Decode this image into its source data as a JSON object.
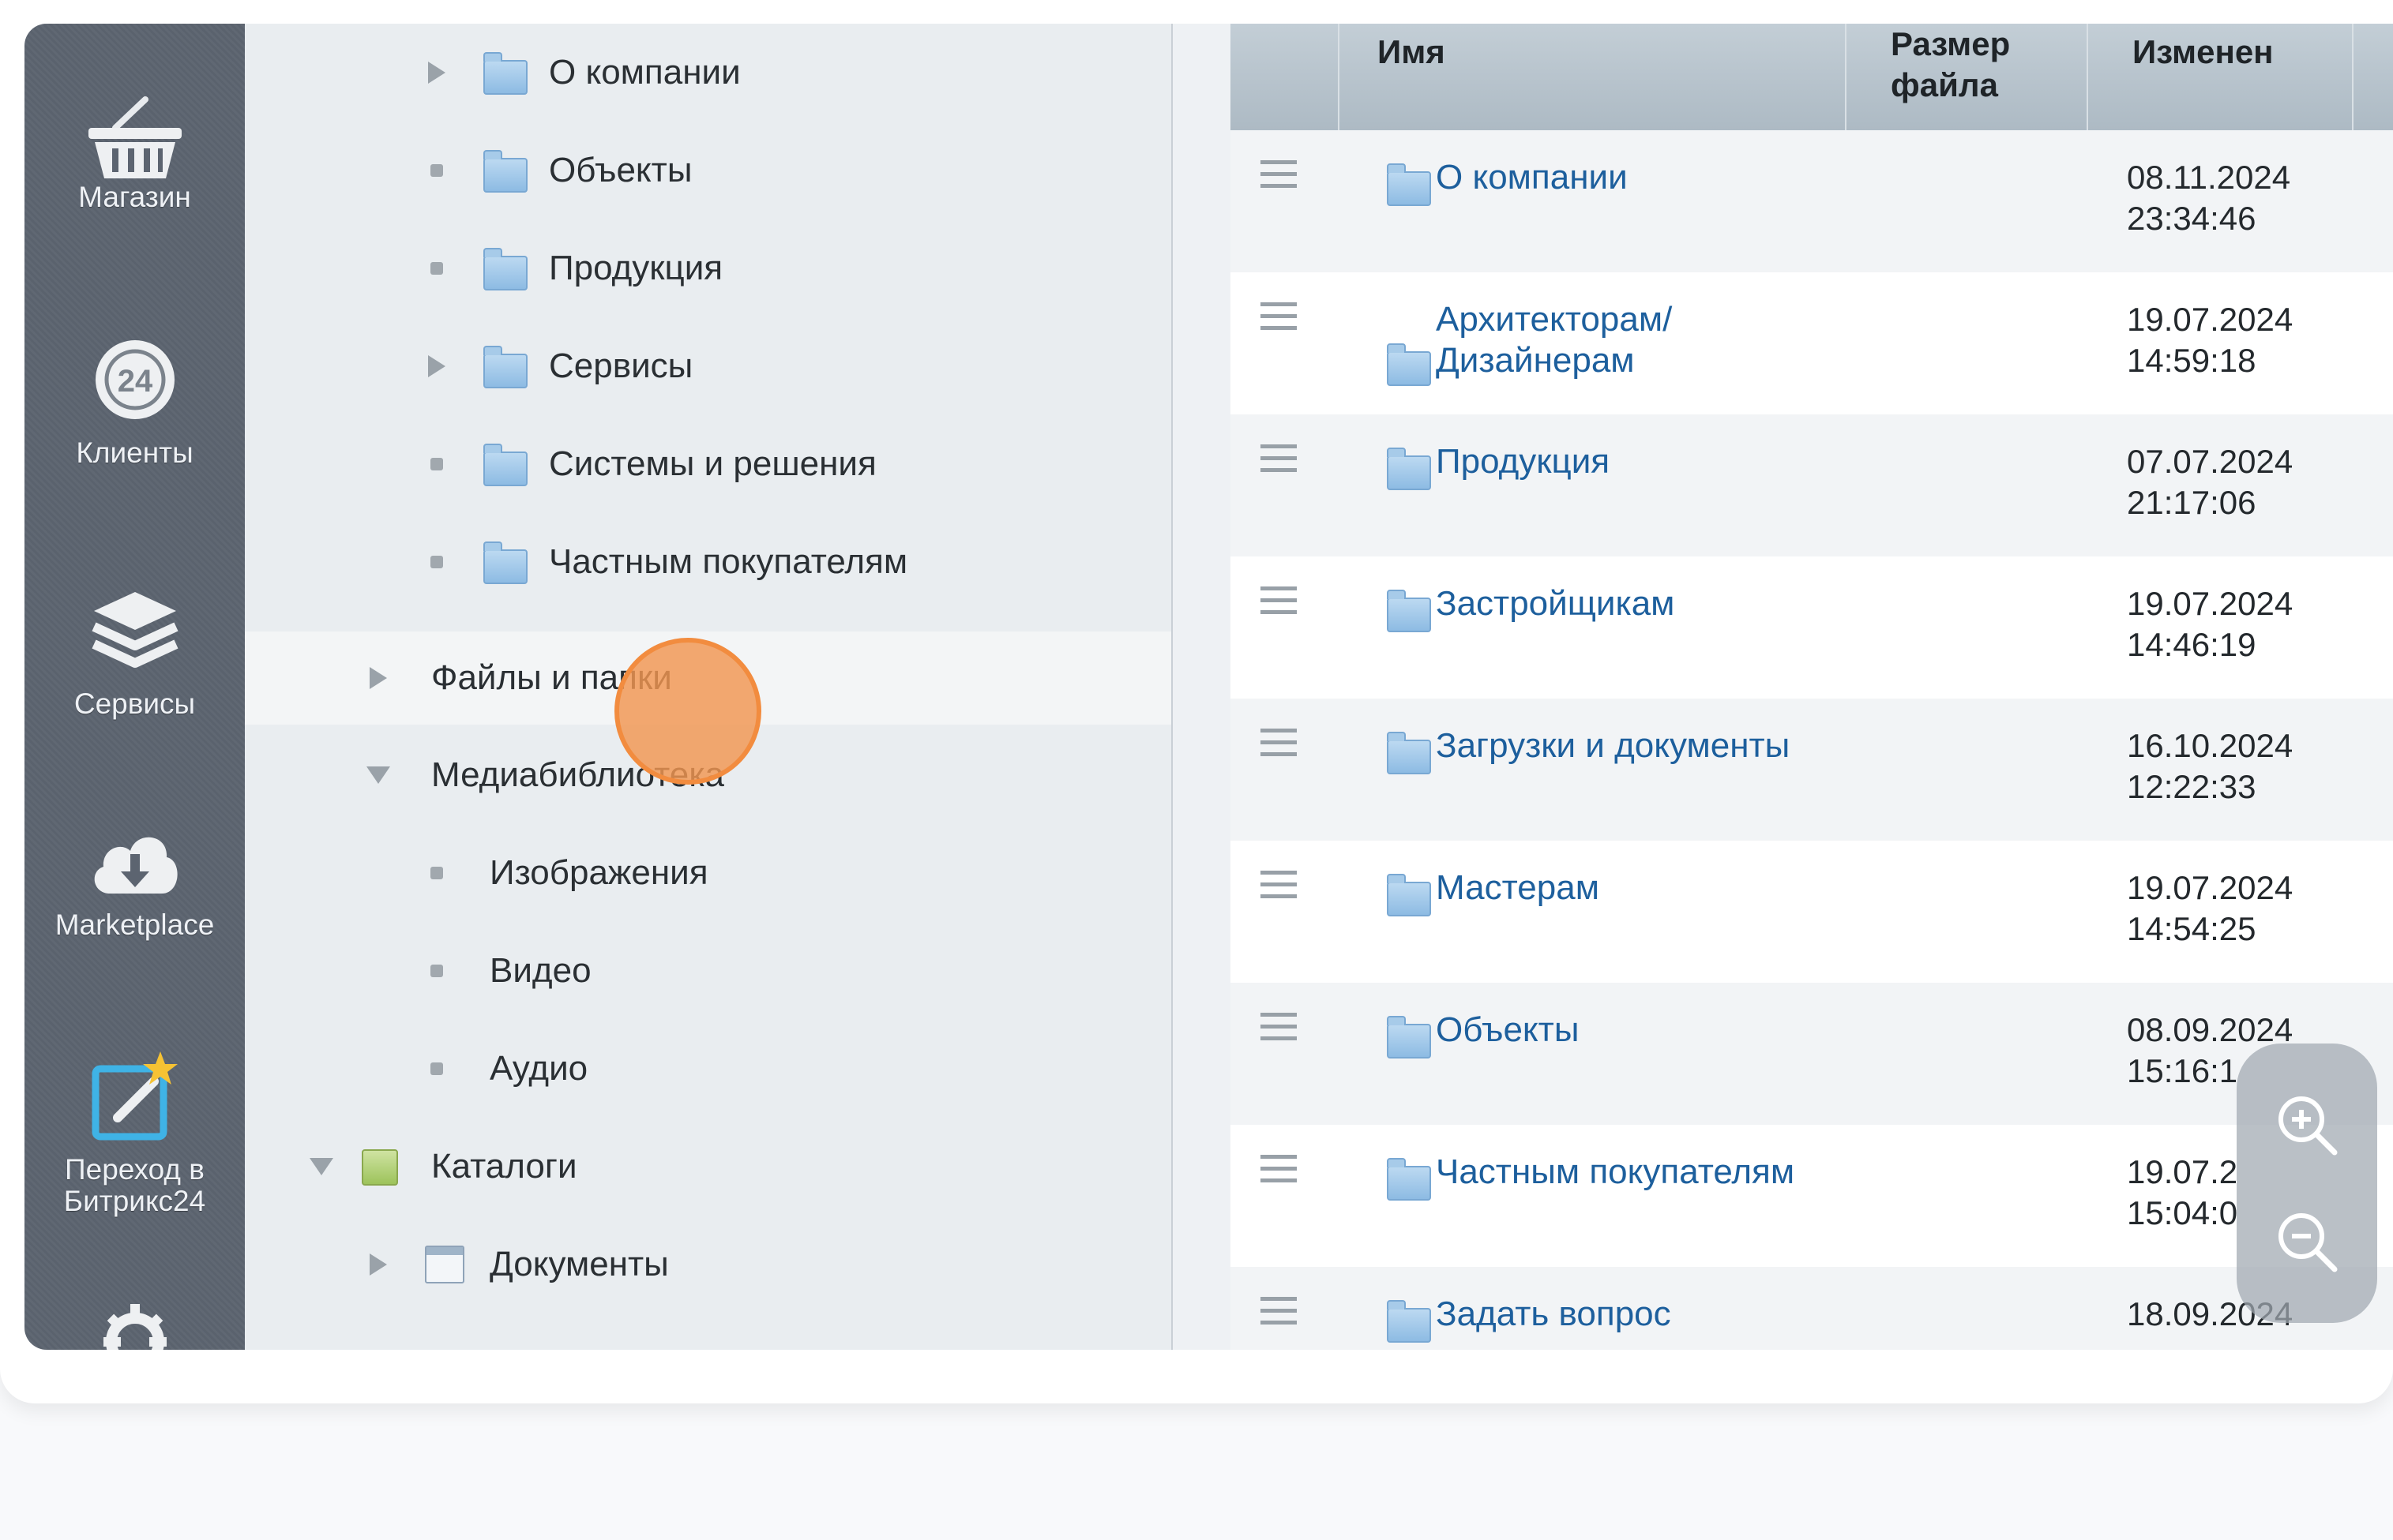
{
  "rail": {
    "items": [
      {
        "label": "Магазин",
        "icon": "basket-icon"
      },
      {
        "label": "Клиенты",
        "icon": "bitrix24-icon"
      },
      {
        "label": "Сервисы",
        "icon": "layers-icon"
      },
      {
        "label": "Marketplace",
        "icon": "cloud-download-icon"
      },
      {
        "label": "Переход в\nБитрикс24",
        "icon": "edit-star-icon"
      },
      {
        "label": "",
        "icon": "gear-icon"
      }
    ]
  },
  "tree": {
    "items": [
      {
        "label": "О компании",
        "marker": "arrow"
      },
      {
        "label": "Объекты",
        "marker": "bullet"
      },
      {
        "label": "Продукция",
        "marker": "bullet"
      },
      {
        "label": "Сервисы",
        "marker": "arrow"
      },
      {
        "label": "Системы и решения",
        "marker": "bullet"
      },
      {
        "label": "Частным покупателям",
        "marker": "bullet"
      },
      {
        "label": "Файлы и папки",
        "marker": "arrow",
        "active": true
      },
      {
        "label": "Медиабиблиотека",
        "marker": "arrow-down"
      },
      {
        "label": "Изображения",
        "marker": "bullet"
      },
      {
        "label": "Видео",
        "marker": "bullet"
      },
      {
        "label": "Аудио",
        "marker": "bullet"
      },
      {
        "label": "Каталоги",
        "marker": "arrow-down"
      },
      {
        "label": "Документы",
        "marker": "arrow"
      }
    ]
  },
  "table": {
    "columns": {
      "name": "Имя",
      "size": "Размер файла",
      "modified": "Изменен"
    },
    "rows": [
      {
        "name": "О компании",
        "modified": "08.11.2024\n23:34:46"
      },
      {
        "name": "Архитекторам/ Дизайнерам",
        "modified": "19.07.2024\n14:59:18"
      },
      {
        "name": "Продукция",
        "modified": "07.07.2024\n21:17:06"
      },
      {
        "name": "Застройщикам",
        "modified": "19.07.2024\n14:46:19"
      },
      {
        "name": "Загрузки и документы",
        "modified": "16.10.2024\n12:22:33"
      },
      {
        "name": "Мастерам",
        "modified": "19.07.2024\n14:54:25"
      },
      {
        "name": "Объекты",
        "modified": "08.09.2024\n15:16:1"
      },
      {
        "name": "Частным покупателям",
        "modified": "19.07.2\n15:04:0"
      },
      {
        "name": "Задать вопрос",
        "modified": "18.09.2024"
      }
    ]
  },
  "colors": {
    "rail_bg": "#5c6470",
    "link": "#1d5f9d",
    "click_marker": "#f28c3f"
  }
}
